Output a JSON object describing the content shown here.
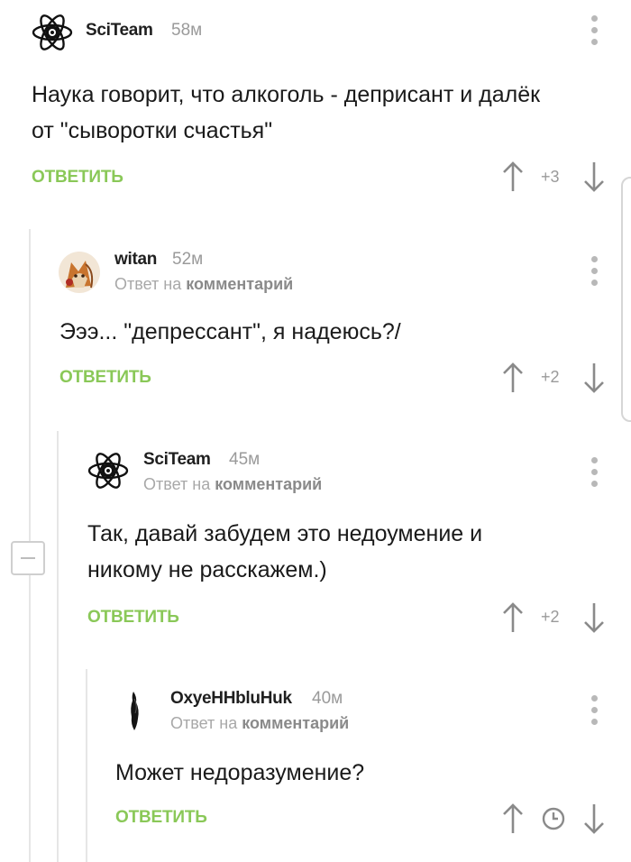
{
  "comments": [
    {
      "username": "SciTeam",
      "time": "58м",
      "reply_prefix": "",
      "reply_link": "",
      "body_lines": [
        "Наука говорит, что алкоголь - деприсант и далёк",
        "от \"сыворотки счастья\""
      ],
      "reply_label": "ОТВЕТИТЬ",
      "score": "+3"
    },
    {
      "username": "witan",
      "time": "52м",
      "reply_prefix": "Ответ на",
      "reply_link": "комментарий",
      "body_lines": [
        "Эээ... \"депрессант\", я надеюсь?/"
      ],
      "reply_label": "ОТВЕТИТЬ",
      "score": "+2"
    },
    {
      "username": "SciTeam",
      "time": "45м",
      "reply_prefix": "Ответ на",
      "reply_link": "комментарий",
      "body_lines": [
        "Так, давай забудем это недоумение и",
        "никому не расскажем.)"
      ],
      "reply_label": "ОТВЕТИТЬ",
      "score": "+2"
    },
    {
      "username": "OxyeHHbluHuk",
      "time": "40м",
      "reply_prefix": "Ответ на",
      "reply_link": "комментарий",
      "body_lines": [
        "Может недоразумение?"
      ],
      "reply_label": "ОТВЕТИТЬ",
      "score_icon": "clock-icon"
    }
  ],
  "colors": {
    "reply_button": "#8ac858",
    "username": "#1f1f1f",
    "meta_text": "#9a9a9a",
    "thread_line": "#e6e6e6"
  },
  "icons": [
    "atom-logo-avatar",
    "fox-avatar",
    "dark-silhouette-avatar",
    "arrow-up-icon",
    "arrow-down-icon",
    "kebab-menu-icon",
    "clock-icon",
    "collapse-minus-icon"
  ]
}
